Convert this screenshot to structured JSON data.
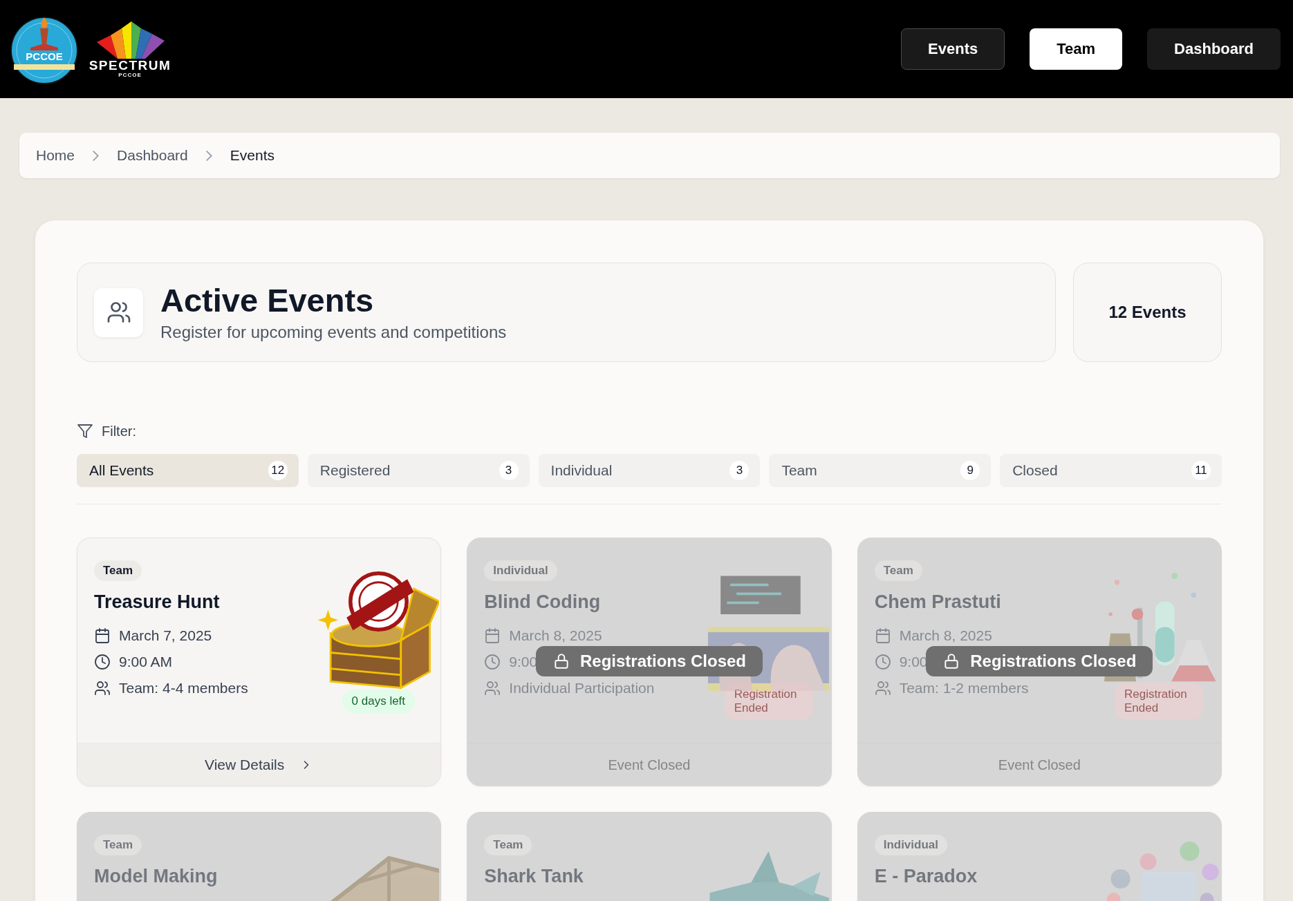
{
  "header": {
    "emblem_text": "PCCOE",
    "brand": "SPECTRUM",
    "brand_sub": "PCCOE",
    "nav": [
      {
        "label": "Events",
        "selected": false,
        "focused": true
      },
      {
        "label": "Team",
        "selected": true,
        "focused": false
      },
      {
        "label": "Dashboard",
        "selected": false,
        "focused": false
      }
    ]
  },
  "breadcrumb": [
    {
      "label": "Home",
      "current": false
    },
    {
      "label": "Dashboard",
      "current": false
    },
    {
      "label": "Events",
      "current": true
    }
  ],
  "summary": {
    "title": "Active Events",
    "subtitle": "Register for upcoming events and competitions",
    "count": "12 Events"
  },
  "filter": {
    "label": "Filter:",
    "options": [
      {
        "label": "All Events",
        "count": "12",
        "selected": true
      },
      {
        "label": "Registered",
        "count": "3",
        "selected": false
      },
      {
        "label": "Individual",
        "count": "3",
        "selected": false
      },
      {
        "label": "Team",
        "count": "9",
        "selected": false
      },
      {
        "label": "Closed",
        "count": "11",
        "selected": false
      }
    ]
  },
  "events": [
    {
      "type": "Team",
      "title": "Treasure Hunt",
      "date": "March 7, 2025",
      "time": "9:00 AM",
      "participants": "Team: 4-4 members",
      "badge": "0 days left",
      "footer": "View Details",
      "closed": false
    },
    {
      "type": "Individual",
      "title": "Blind Coding",
      "date": "March 8, 2025",
      "time": "9:00",
      "participants": "Individual Participation",
      "badge": "Registration Ended",
      "footer": "Event Closed",
      "overlay": "Registrations Closed",
      "closed": true
    },
    {
      "type": "Team",
      "title": "Chem Prastuti",
      "date": "March 8, 2025",
      "time": "9:00",
      "participants": "Team: 1-2 members",
      "badge": "Registration Ended",
      "footer": "Event Closed",
      "overlay": "Registrations Closed",
      "closed": true
    },
    {
      "type": "Team",
      "title": "Model Making",
      "closed": true
    },
    {
      "type": "Team",
      "title": "Shark Tank",
      "closed": true
    },
    {
      "type": "Individual",
      "title": "E - Paradox",
      "closed": true
    }
  ]
}
